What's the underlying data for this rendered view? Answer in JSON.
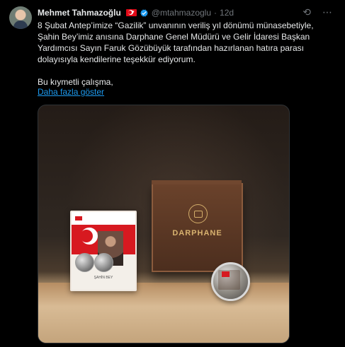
{
  "tweet": {
    "author_name": "Mehmet Tahmazoğlu",
    "handle": "@mtahmazoglu",
    "separator": "·",
    "time": "12d",
    "text_lines": [
      "8 Şubat Antep’imize “Gazilik” unvanının veriliş yıl dönümü münasebetiyle,",
      "Şahin Bey’imiz anısına Darphane Genel Müdürü ve Gelir İdaresi Başkan",
      "Yardımcısı Sayın Faruk Gözübüyük tarafından hazırlanan hatıra parası",
      "dolayısıyla kendilerine teşekkür ediyorum.",
      "Bu kıymetli çalışma,"
    ],
    "show_more": "Daha fazla göster",
    "media": {
      "box_label": "DARPHANE",
      "card_name": "ŞAHİN BEY"
    }
  },
  "icons": {
    "avatar": "avatar-photo",
    "flag": "turkey-flag-icon",
    "verified": "verified-badge-icon",
    "grok": "grok-icon",
    "more": "more-options-icon"
  },
  "colors": {
    "background": "#000000",
    "text": "#e7e9ea",
    "muted": "#71767b",
    "link": "#1d9bf0",
    "flag_red": "#e30a17"
  }
}
